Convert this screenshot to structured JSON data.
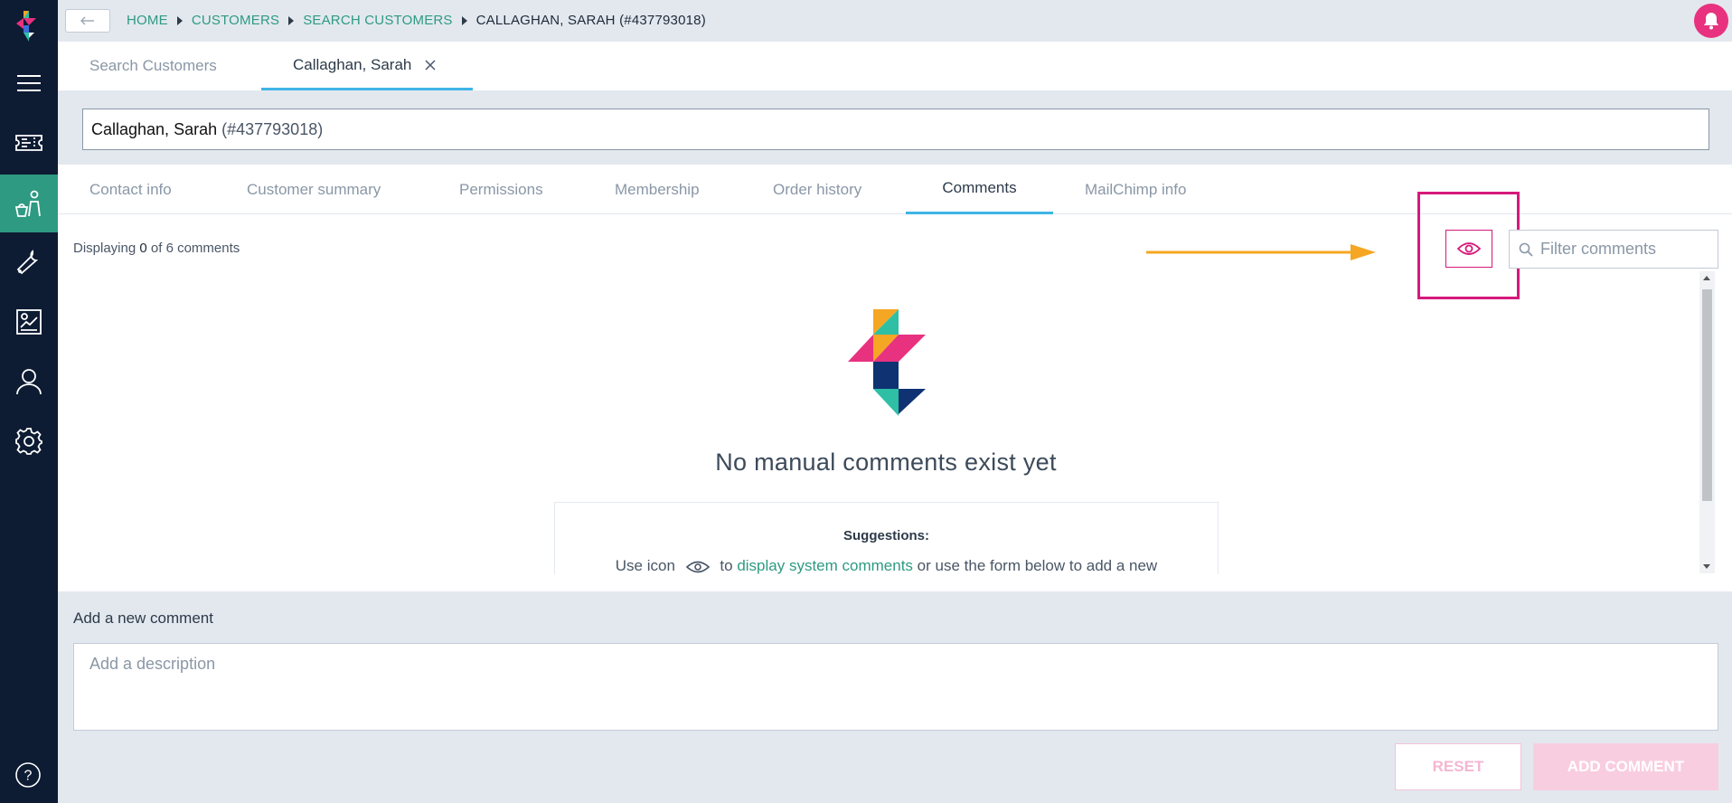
{
  "colors": {
    "sidebar_bg": "#0d1b33",
    "active_nav": "#2e9a82",
    "link": "#2e9a82",
    "accent_pink": "#e8317f",
    "tab_underline": "#3fb4e6",
    "arrow": "#f5a623"
  },
  "sidebar": {
    "items": [
      {
        "icon": "menu-icon"
      },
      {
        "icon": "ticket-icon"
      },
      {
        "icon": "customers-icon",
        "active": true
      },
      {
        "icon": "tools-icon"
      },
      {
        "icon": "reports-icon"
      },
      {
        "icon": "user-icon"
      },
      {
        "icon": "settings-icon"
      }
    ],
    "help_label": "?"
  },
  "breadcrumb": {
    "items": [
      "HOME",
      "CUSTOMERS",
      "SEARCH CUSTOMERS"
    ],
    "current": "CALLAGHAN, SARAH (#437793018)"
  },
  "top_tabs": [
    {
      "label": "Search Customers"
    },
    {
      "label": "Callaghan, Sarah",
      "closable": true
    }
  ],
  "customer": {
    "name": "Callaghan, Sarah",
    "id": "(#437793018)"
  },
  "sub_tabs": [
    {
      "label": "Contact info"
    },
    {
      "label": "Customer summary"
    },
    {
      "label": "Permissions"
    },
    {
      "label": "Membership"
    },
    {
      "label": "Order history"
    },
    {
      "label": "Comments",
      "active": true
    },
    {
      "label": "MailChimp info"
    }
  ],
  "comments": {
    "displaying_prefix": "Displaying",
    "shown": "0",
    "of_text": "of 6 comments",
    "filter_placeholder": "Filter comments",
    "empty_title": "No manual comments exist yet",
    "suggestions_title": "Suggestions:",
    "suggestion_before": "Use icon",
    "suggestion_link": "display system comments",
    "suggestion_to": "to",
    "suggestion_after": "or use the form below to add a new"
  },
  "new_comment": {
    "label": "Add a new comment",
    "placeholder": "Add a description",
    "reset_label": "RESET",
    "add_label": "ADD COMMENT"
  }
}
